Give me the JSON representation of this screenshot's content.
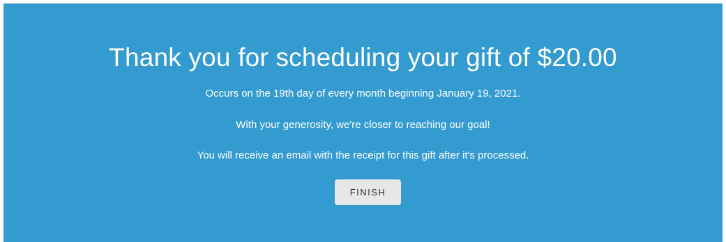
{
  "confirmation": {
    "title": "Thank you for scheduling your gift of $20.00",
    "schedule_text": "Occurs on the 19th day of every month beginning January 19, 2021.",
    "generosity_text": "With your generosity, we're closer to reaching our goal!",
    "receipt_text": "You will receive an email with the receipt for this gift after it's processed.",
    "finish_label": "FINISH"
  },
  "colors": {
    "panel_background": "#339bcf",
    "text": "#ffffff",
    "button_background": "#e7e7e7",
    "button_text": "#333333"
  }
}
